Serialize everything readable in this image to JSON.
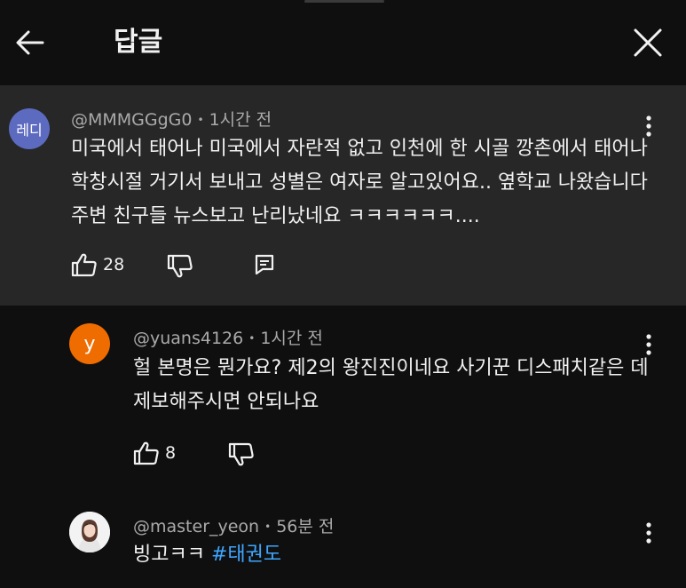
{
  "header": {
    "title": "답글",
    "back_icon": "arrow-left-icon",
    "close_icon": "close-icon"
  },
  "comments": [
    {
      "avatar_text": "레디",
      "avatar_color": "#5c6bc0",
      "author": "@MMMGGgG0",
      "time": "1시간 전",
      "lines": [
        "미국에서 태어나 미국에서 자란적 없고 인천에 한 시골 깡촌에서 태어나",
        "학창시절 거기서 보내고 성별은 여자로 알고있어요.. 옆학교 나왔습니다",
        "주변 친구들 뉴스보고 난리났네요 ㅋㅋㅋㅋㅋㅋ...."
      ],
      "likes": "28"
    },
    {
      "avatar_text": "y",
      "avatar_color": "#ef6c00",
      "author": "@yuans4126",
      "time": "1시간 전",
      "lines": [
        "헐 본명은 뭔가요? 제2의 왕진진이네요 사기꾼 디스패치같은 데",
        "제보해주시면 안되나요"
      ],
      "likes": "8"
    },
    {
      "avatar_color": "#f5f5f5",
      "author": "@master_yeon",
      "time": "56분 전",
      "text": "빙고ㅋㅋ ",
      "hashtag": "#태권도"
    }
  ],
  "icons": {
    "like": "thumbs-up-icon",
    "dislike": "thumbs-down-icon",
    "reply": "reply-icon",
    "more": "more-vertical-icon"
  },
  "separator": "•",
  "colors": {
    "background": "#0f0f0f",
    "highlight": "#272727",
    "hashtag": "#3ea6ff",
    "meta": "#aaaaaa"
  }
}
